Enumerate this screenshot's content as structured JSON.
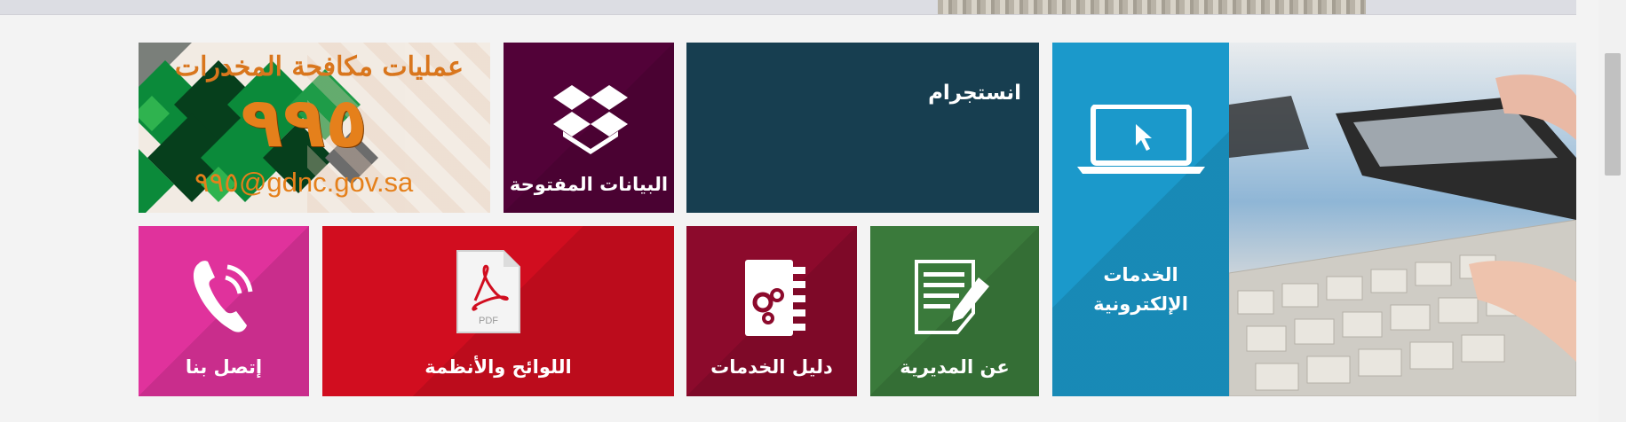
{
  "banner": {
    "title_ar": "عمليات مكافحة المخدرات",
    "number": "٩٩٥",
    "email": "٩٩٥@gdnc.gov.sa",
    "colors": {
      "accent": "#e5801b",
      "green": "#0b8a3a",
      "dark_green": "#063f1c"
    }
  },
  "tiles": {
    "open_data": {
      "label": "البيانات المفتوحة",
      "icon": "dropbox-box-icon",
      "color": "#520238"
    },
    "instagram": {
      "label": "انستجرام",
      "color": "#173e50"
    },
    "eservices": {
      "label_line1": "الخدمات",
      "label_line2": "الإلكترونية",
      "icon": "laptop-cursor-icon",
      "color": "#1b99cb"
    },
    "contact": {
      "label": "إتصل بنا",
      "icon": "phone-icon",
      "color": "#e0329c"
    },
    "regulations": {
      "label": "اللوائح والأنظمة",
      "icon": "pdf-document-icon",
      "color": "#d10d1f"
    },
    "services_guide": {
      "label": "دليل الخدمات",
      "icon": "gear-notebook-icon",
      "color": "#8c0a2c"
    },
    "about": {
      "label": "عن المديرية",
      "icon": "document-pen-icon",
      "color": "#3a7a3b"
    }
  }
}
